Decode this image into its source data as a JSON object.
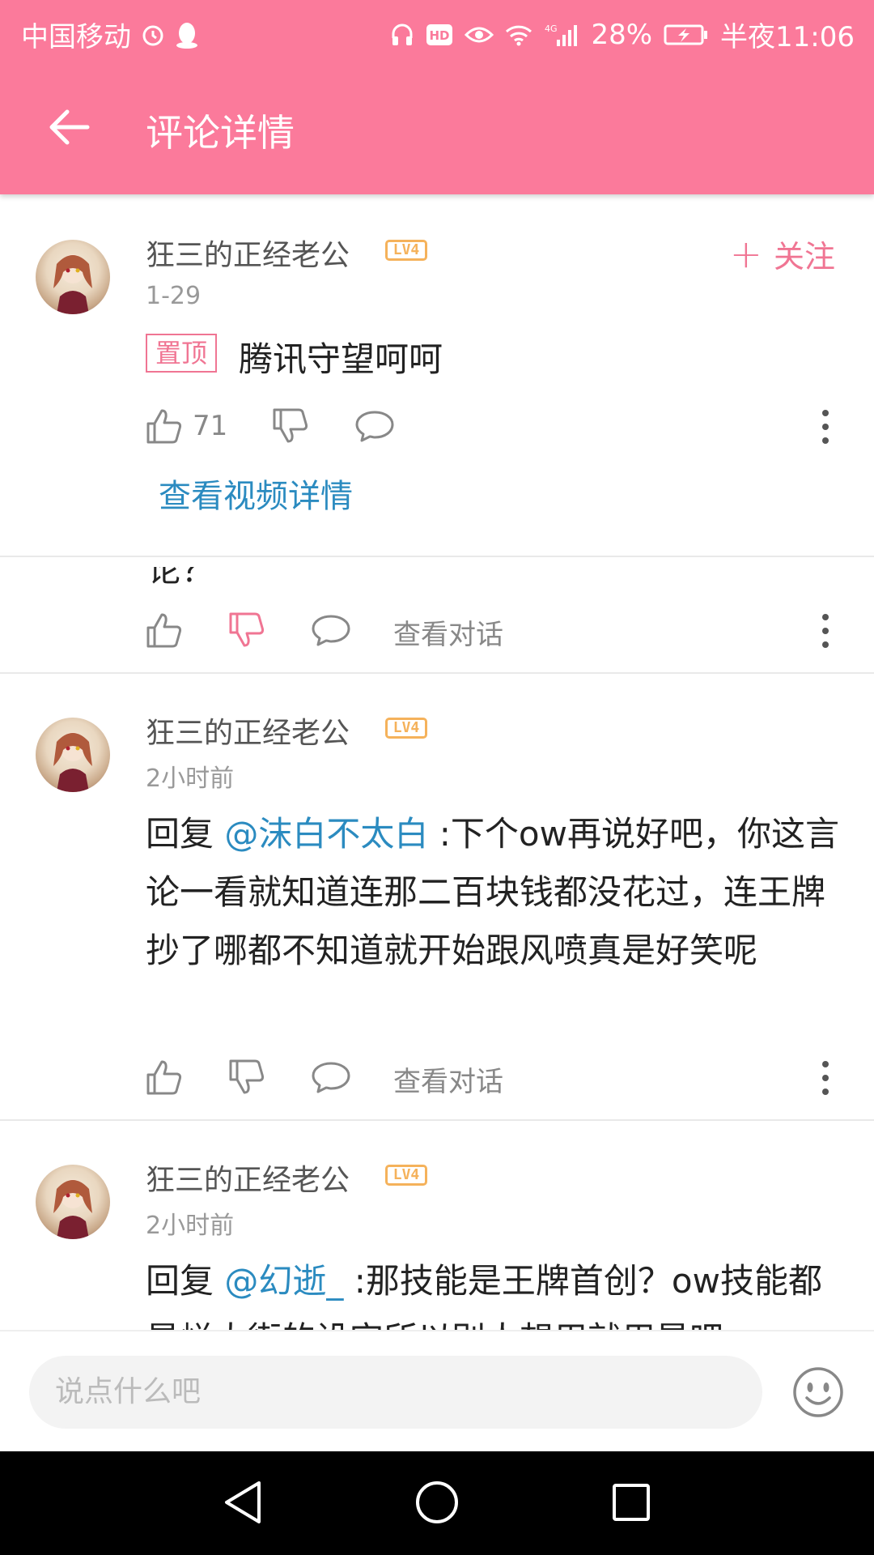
{
  "status_bar": {
    "carrier": "中国移动",
    "network": "4G",
    "battery": "28%",
    "time": "半夜11:06"
  },
  "app_bar": {
    "title": "评论详情"
  },
  "pinned_comment": {
    "username": "狂三的正经老公",
    "level": "LV4",
    "time": "1-29",
    "follow_label": "关注",
    "tag": "置顶",
    "text": "腾讯守望呵呵",
    "like_count": "71",
    "video_link": "查看视频详情"
  },
  "partial_comment": {
    "cut_text": "论？",
    "view_dialog": "查看对话"
  },
  "replies": [
    {
      "username": "狂三的正经老公",
      "level": "LV4",
      "time": "2小时前",
      "prefix": "回复",
      "mention": "@沫白不太白",
      "text": ":下个ow再说好吧，你这言论一看就知道连那二百块钱都没花过，连王牌抄了哪都不知道就开始跟风喷真是好笑呢",
      "view_dialog": "查看对话"
    },
    {
      "username": "狂三的正经老公",
      "level": "LV4",
      "time": "2小时前",
      "prefix": "回复",
      "mention": "@幻逝_",
      "text": ":那技能是王牌首创？ow技能都是烂大街的设定所以别人想用就用是吧"
    }
  ],
  "input_bar": {
    "placeholder": "说点什么吧"
  },
  "colors": {
    "header_pink": "#fb7a9b",
    "accent_pink": "#f07593",
    "link_blue": "#2b8bc0",
    "level_orange": "#f5b25b"
  }
}
